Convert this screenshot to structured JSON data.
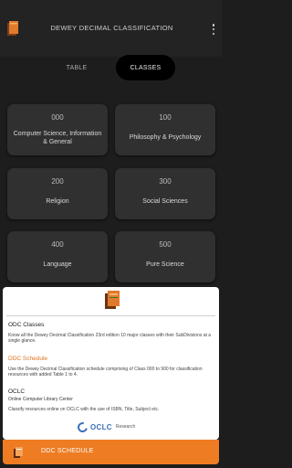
{
  "header": {
    "title": "DEWEY DECIMAL CLASSIFICATION"
  },
  "tabs": [
    {
      "label": "TABLE",
      "selected": false
    },
    {
      "label": "CLASSES",
      "selected": true
    }
  ],
  "classes": [
    {
      "number": "000",
      "label": "Computer Science, Information & General"
    },
    {
      "number": "100",
      "label": "Philosophy & Psychology"
    },
    {
      "number": "200",
      "label": "Religion"
    },
    {
      "number": "300",
      "label": "Social Sciences"
    },
    {
      "number": "400",
      "label": "Language"
    },
    {
      "number": "500",
      "label": "Pure Science"
    }
  ],
  "info_panel": {
    "odc_title": "ODC Classes",
    "odc_desc": "Know all the Dewey Decimal Classification 23rd edition 10 major classes with their SubDivisions at a single glance.",
    "schedule_title": "DDC Schedule",
    "schedule_desc": "Use the Dewey Decimal Classification schedule comprising of Class 000 to 900 for classification resources with added Table 1 to 4.",
    "oclc_title": "OCLC",
    "oclc_subtitle": "Online Computer Library Center",
    "oclc_desc": "Classify resources online on OCLC with the use of ISBN, Title, Subject etc.",
    "oclc_brand": "OCLC",
    "oclc_research": "Research"
  },
  "bottom_bar": {
    "label": "DDC SCHEDULE"
  },
  "colors": {
    "background": "#1d1d1d",
    "card": "#303030",
    "accent_orange": "#ee7c23",
    "oclc_blue": "#3b6fb6"
  },
  "icons": {
    "app_logo": "book-icon",
    "menu": "more-vertical-icon",
    "panel_logo": "book-icon",
    "bottom": "book-icon"
  }
}
